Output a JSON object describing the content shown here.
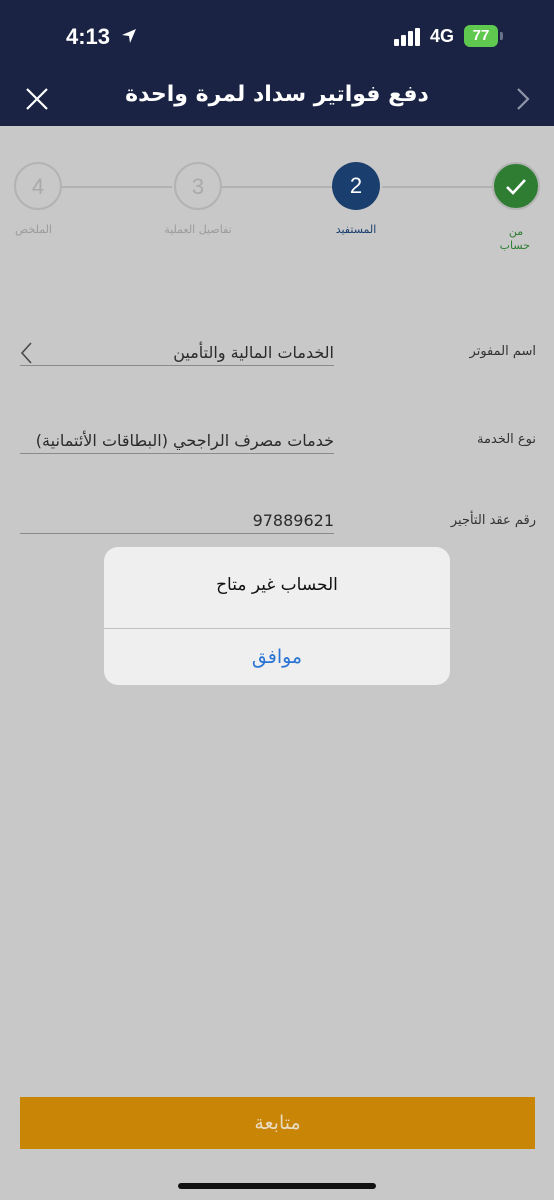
{
  "status_bar": {
    "time": "4:13",
    "network": "4G",
    "battery": "77"
  },
  "header": {
    "title": "دفع فواتير سداد لمرة واحدة"
  },
  "steps": [
    {
      "number": "1",
      "label": "من حساب",
      "state": "done"
    },
    {
      "number": "2",
      "label": "المستفيد",
      "state": "active"
    },
    {
      "number": "3",
      "label": "تفاصيل العملية",
      "state": "inactive"
    },
    {
      "number": "4",
      "label": "الملخص",
      "state": "inactive"
    }
  ],
  "fields": {
    "biller_label": "اسم المفوتر",
    "biller_value": "الخدمات المالية والتأمين",
    "service_label": "نوع الخدمة",
    "service_value": "خدمات مصرف الراجحي (البطاقات الأئتمانية)",
    "contract_label": "رقم عقد التأجير",
    "contract_value": "97889621"
  },
  "dialog": {
    "message": "الحساب غير متاح",
    "ok_label": "موافق"
  },
  "footer": {
    "continue_label": "متابعة"
  },
  "colors": {
    "header_bg": "#1a2344",
    "active_step": "#1a3f6e",
    "done_step": "#2e7d32",
    "accent_button": "#c98506",
    "dialog_link": "#2a75d4"
  }
}
